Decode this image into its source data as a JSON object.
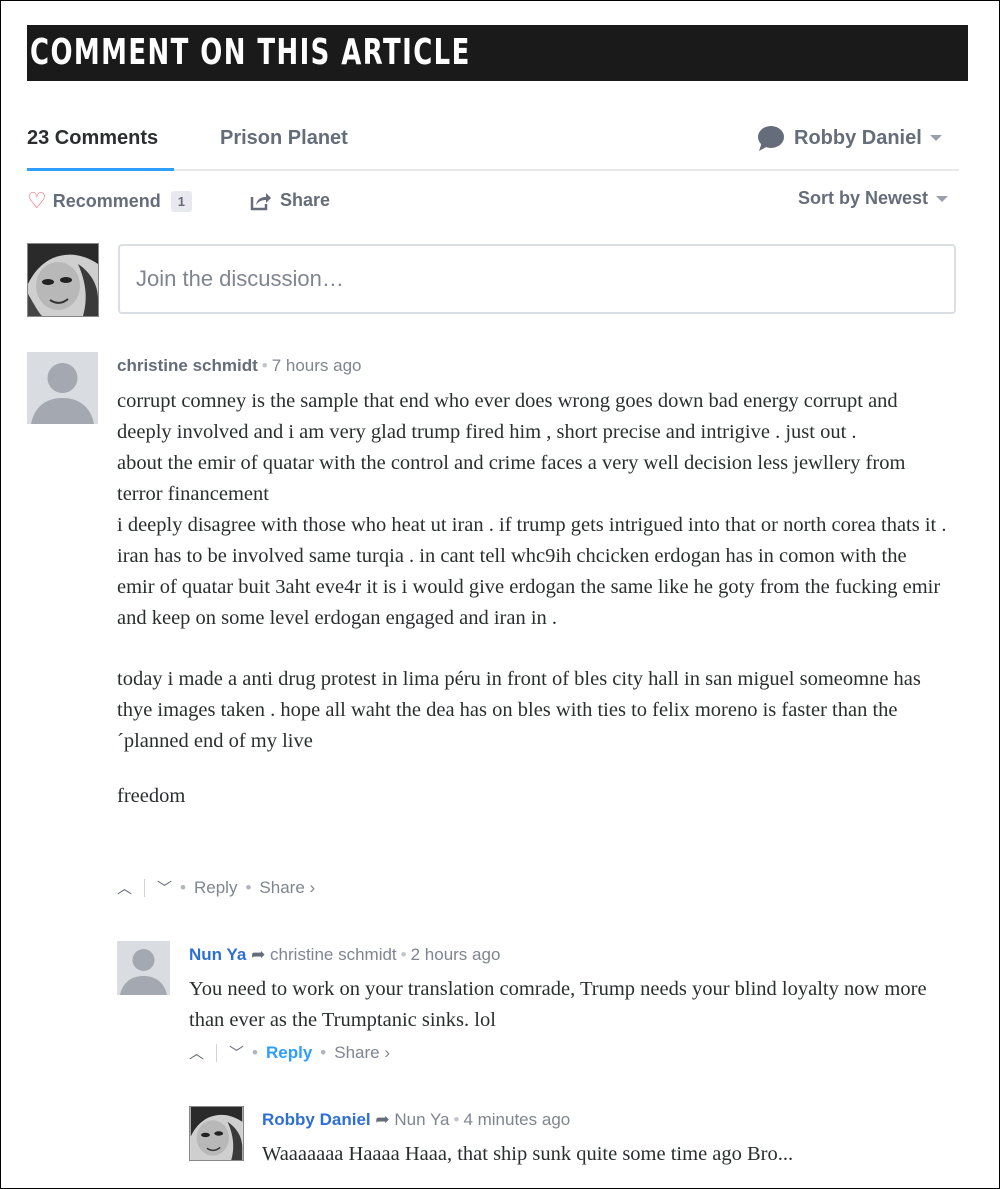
{
  "header": {
    "banner": "COMMENT ON THIS ARTICLE"
  },
  "nav": {
    "comment_count": "23 Comments",
    "site": "Prison Planet",
    "user_name": "Robby Daniel"
  },
  "toolbar": {
    "recommend_label": "Recommend",
    "recommend_count": "1",
    "share_label": "Share",
    "sort_label": "Sort by Newest"
  },
  "composer": {
    "placeholder": "Join the discussion…"
  },
  "comments": [
    {
      "author": "christine schmidt",
      "time": "7 hours ago",
      "paragraphs": [
        "corrupt comney is the sample that end who ever does wrong goes down bad energy corrupt and deeply involved and i am very glad trump fired him , short precise and intrigive . just out .",
        "about the emir of quatar with the control and crime faces a very well decision less jewllery from terror financement",
        "i deeply disagree with those who heat ut iran . if trump gets intrigued into that or north corea thats it . iran has to be involved same turqia . in cant tell whc9ih chcicken erdogan has in comon with the emir of quatar buit 3aht eve4r it is i would give erdogan the same like he goty from the fucking emir and keep on some level erdogan engaged and iran in .",
        "today i made a anti drug protest in lima péru in front of bles city hall in san miguel someomne has thye images taken . hope all waht the dea has on bles with ties to felix moreno is faster than the ´planned end of my live",
        "freedom"
      ],
      "reply_label": "Reply",
      "share_label": "Share ›"
    },
    {
      "author": "Nun Ya",
      "parent": "christine schmidt",
      "time": "2 hours ago",
      "text": "You need to work on your translation comrade, Trump needs your blind loyalty now more than ever as the Trumptanic sinks. lol",
      "reply_label": "Reply",
      "share_label": "Share ›"
    },
    {
      "author": "Robby Daniel",
      "parent": "Nun Ya",
      "time": "4 minutes ago",
      "text": "Waaaaaaa Haaaa Haaa, that ship sunk quite some time ago Bro..."
    }
  ],
  "colors": {
    "banner_bg": "#1a1a1a",
    "link_blue": "#2e6fd6",
    "reply_blue": "#2e9fff",
    "heart": "#f05f70",
    "muted": "#656c7a"
  }
}
